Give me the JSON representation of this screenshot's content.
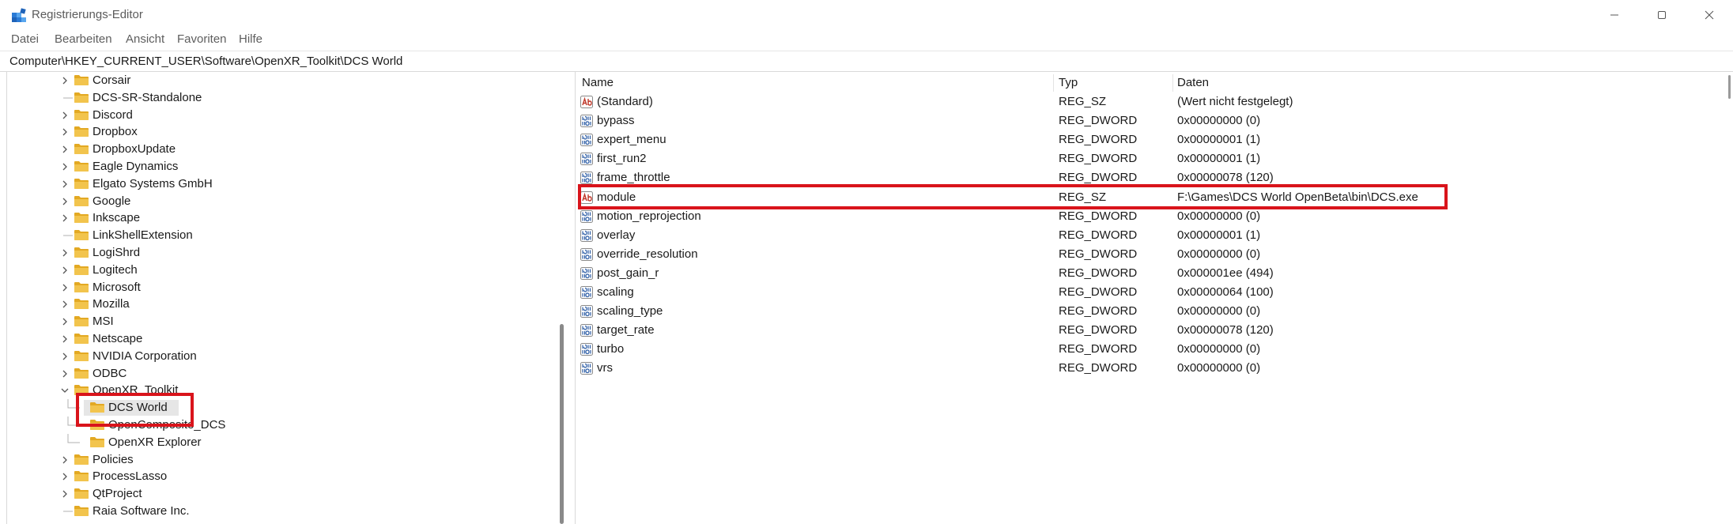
{
  "window": {
    "title": "Registrierungs-Editor"
  },
  "menu": [
    "Datei",
    "Bearbeiten",
    "Ansicht",
    "Favoriten",
    "Hilfe"
  ],
  "address": "Computer\\HKEY_CURRENT_USER\\Software\\OpenXR_Toolkit\\DCS World",
  "tree": {
    "items": [
      {
        "label": "Corsair",
        "expandable": true
      },
      {
        "label": "DCS-SR-Standalone",
        "expandable": false
      },
      {
        "label": "Discord",
        "expandable": true
      },
      {
        "label": "Dropbox",
        "expandable": true
      },
      {
        "label": "DropboxUpdate",
        "expandable": true
      },
      {
        "label": "Eagle Dynamics",
        "expandable": true
      },
      {
        "label": "Elgato Systems GmbH",
        "expandable": true
      },
      {
        "label": "Google",
        "expandable": true
      },
      {
        "label": "Inkscape",
        "expandable": true
      },
      {
        "label": "LinkShellExtension",
        "expandable": false
      },
      {
        "label": "LogiShrd",
        "expandable": true
      },
      {
        "label": "Logitech",
        "expandable": true
      },
      {
        "label": "Microsoft",
        "expandable": true
      },
      {
        "label": "Mozilla",
        "expandable": true
      },
      {
        "label": "MSI",
        "expandable": true
      },
      {
        "label": "Netscape",
        "expandable": true
      },
      {
        "label": "NVIDIA Corporation",
        "expandable": true
      },
      {
        "label": "ODBC",
        "expandable": true
      },
      {
        "label": "OpenXR_Toolkit",
        "expandable": true,
        "expanded": true
      },
      {
        "label": "DCS World",
        "child": true,
        "selected": true
      },
      {
        "label": "OpenComposite_DCS",
        "child": true
      },
      {
        "label": "OpenXR Explorer",
        "child": true
      },
      {
        "label": "Policies",
        "expandable": true
      },
      {
        "label": "ProcessLasso",
        "expandable": true
      },
      {
        "label": "QtProject",
        "expandable": true
      },
      {
        "label": "Raia Software Inc.",
        "expandable": false
      }
    ]
  },
  "list": {
    "headers": {
      "name": "Name",
      "type": "Typ",
      "data": "Daten"
    },
    "rows": [
      {
        "name": "(Standard)",
        "type": "REG_SZ",
        "data": "(Wert nicht festgelegt)",
        "icon": "string"
      },
      {
        "name": "bypass",
        "type": "REG_DWORD",
        "data": "0x00000000 (0)",
        "icon": "binary"
      },
      {
        "name": "expert_menu",
        "type": "REG_DWORD",
        "data": "0x00000001 (1)",
        "icon": "binary"
      },
      {
        "name": "first_run2",
        "type": "REG_DWORD",
        "data": "0x00000001 (1)",
        "icon": "binary"
      },
      {
        "name": "frame_throttle",
        "type": "REG_DWORD",
        "data": "0x00000078 (120)",
        "icon": "binary"
      },
      {
        "name": "module",
        "type": "REG_SZ",
        "data": "F:\\Games\\DCS World OpenBeta\\bin\\DCS.exe",
        "icon": "string"
      },
      {
        "name": "motion_reprojection",
        "type": "REG_DWORD",
        "data": "0x00000000 (0)",
        "icon": "binary"
      },
      {
        "name": "overlay",
        "type": "REG_DWORD",
        "data": "0x00000001 (1)",
        "icon": "binary"
      },
      {
        "name": "override_resolution",
        "type": "REG_DWORD",
        "data": "0x00000000 (0)",
        "icon": "binary"
      },
      {
        "name": "post_gain_r",
        "type": "REG_DWORD",
        "data": "0x000001ee (494)",
        "icon": "binary"
      },
      {
        "name": "scaling",
        "type": "REG_DWORD",
        "data": "0x00000064 (100)",
        "icon": "binary"
      },
      {
        "name": "scaling_type",
        "type": "REG_DWORD",
        "data": "0x00000000 (0)",
        "icon": "binary"
      },
      {
        "name": "target_rate",
        "type": "REG_DWORD",
        "data": "0x00000078 (120)",
        "icon": "binary"
      },
      {
        "name": "turbo",
        "type": "REG_DWORD",
        "data": "0x00000000 (0)",
        "icon": "binary"
      },
      {
        "name": "vrs",
        "type": "REG_DWORD",
        "data": "0x00000000 (0)",
        "icon": "binary"
      }
    ]
  },
  "colors": {
    "highlight": "#d9141b",
    "folder": "#f2c44d",
    "string_icon": "#c0392b",
    "binary_icon": "#2f5fa7"
  }
}
